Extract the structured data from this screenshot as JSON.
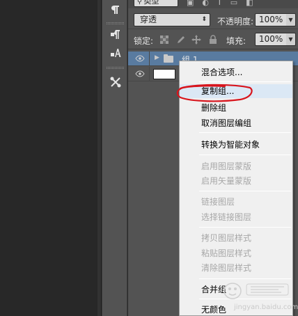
{
  "layers_panel": {
    "filter": {
      "kind_label": "类型"
    },
    "blend_mode": "穿透",
    "opacity_label": "不透明度:",
    "opacity_value": "100%",
    "lock_label": "锁定:",
    "fill_label": "填充:",
    "fill_value": "100%",
    "layers": [
      {
        "name": "组 1",
        "type": "group",
        "visible": true
      },
      {
        "name": "",
        "type": "layer",
        "visible": true
      }
    ]
  },
  "context_menu": {
    "items": [
      {
        "label": "混合选项...",
        "enabled": true
      },
      {
        "label": "复制组...",
        "enabled": true,
        "highlighted": true
      },
      {
        "label": "删除组",
        "enabled": true
      },
      {
        "label": "取消图层编组",
        "enabled": true
      },
      {
        "label": "转换为智能对象",
        "enabled": true
      },
      {
        "label": "启用图层蒙版",
        "enabled": false
      },
      {
        "label": "启用矢量蒙版",
        "enabled": false
      },
      {
        "label": "链接图层",
        "enabled": false
      },
      {
        "label": "选择链接图层",
        "enabled": false
      },
      {
        "label": "拷贝图层样式",
        "enabled": false
      },
      {
        "label": "粘贴图层样式",
        "enabled": false
      },
      {
        "label": "清除图层样式",
        "enabled": false
      },
      {
        "label": "合并组",
        "enabled": true
      },
      {
        "label": "无颜色",
        "enabled": true
      }
    ]
  },
  "watermark": {
    "url": "jingyan.baidu.com"
  },
  "colors": {
    "panel_bg": "#535353",
    "menu_bg": "#f0f0f0",
    "annotation_red": "#d8141c",
    "disabled_text": "#a7a7a7"
  }
}
